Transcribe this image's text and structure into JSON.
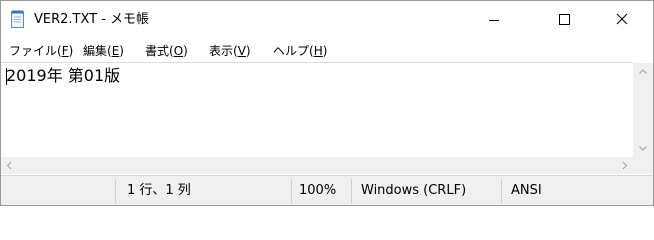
{
  "window": {
    "title": "VER2.TXT - メモ帳",
    "app_icon": "notepad-icon",
    "controls": {
      "minimize_icon": "minimize-icon",
      "maximize_icon": "maximize-icon",
      "close_icon": "close-icon"
    }
  },
  "menu": {
    "items": [
      {
        "label": "ファイル(",
        "accel": "F",
        "suffix": ")"
      },
      {
        "label": "編集(",
        "accel": "E",
        "suffix": ")"
      },
      {
        "label": "書式(",
        "accel": "O",
        "suffix": ")"
      },
      {
        "label": "表示(",
        "accel": "V",
        "suffix": ")"
      },
      {
        "label": "ヘルプ(",
        "accel": "H",
        "suffix": ")"
      }
    ]
  },
  "editor": {
    "content": "2019年 第01版"
  },
  "statusbar": {
    "position": "1 行、1 列",
    "zoom": "100%",
    "line_ending": "Windows (CRLF)",
    "encoding": "ANSI"
  }
}
